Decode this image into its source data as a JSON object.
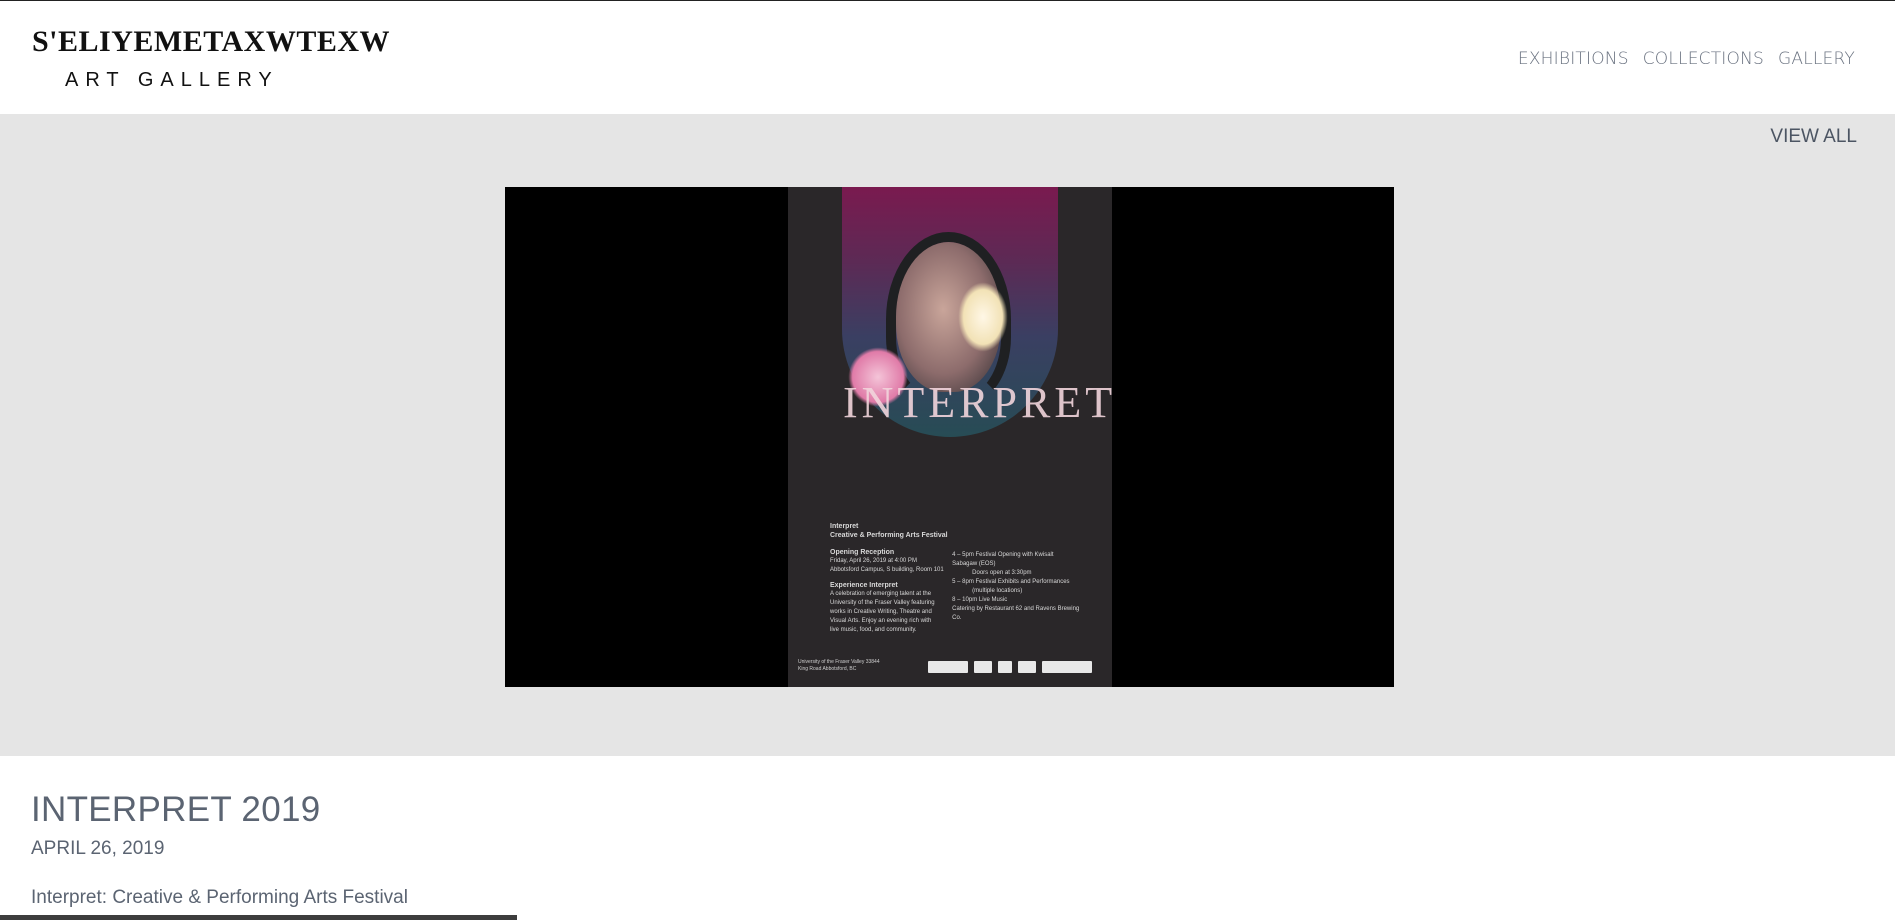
{
  "header": {
    "logo_line1": "S'ELIYEMETAXWTEXW",
    "logo_line2": "ART GALLERY",
    "nav": [
      {
        "label": "EXHIBITIONS"
      },
      {
        "label": "COLLECTIONS"
      },
      {
        "label": "GALLERY"
      }
    ]
  },
  "gallery": {
    "view_all_label": "VIEW ALL",
    "image_alt_word": "INTERPRET",
    "poster": {
      "heading": "Interpret",
      "subheading": "Creative & Performing Arts Festival",
      "reception_label": "Opening Reception",
      "reception_when": "Friday, April 26, 2019 at 4:00 PM",
      "reception_where": "Abbotsford Campus, S building, Room 101",
      "experience_label": "Experience Interpret",
      "experience_text": "A celebration of emerging talent at the University of the Fraser Valley featuring works in Creative Writing, Theatre and Visual Arts. Enjoy an evening rich with live music, food, and community.",
      "schedule": [
        "4 – 5pm  Festival Opening with Kwisalt Sabagaw (EOS)",
        "Doors open at 3:30pm",
        "5 – 8pm  Festival Exhibits and Performances",
        "(multiple locations)",
        "8 – 10pm Live Music",
        "Catering by Restaurant 62 and Ravens Brewing Co."
      ],
      "footer": "University of the Fraser Valley 33844 King Road Abbotsford, BC"
    }
  },
  "details": {
    "title": "INTERPRET 2019",
    "date": "APRIL 26, 2019",
    "description": "Interpret: Creative & Performing Arts Festival"
  },
  "progress": {
    "fraction": 0.273
  },
  "colors": {
    "band_bg": "#e5e5e5",
    "text": "#5b6472",
    "viewer_bg": "#000000"
  }
}
